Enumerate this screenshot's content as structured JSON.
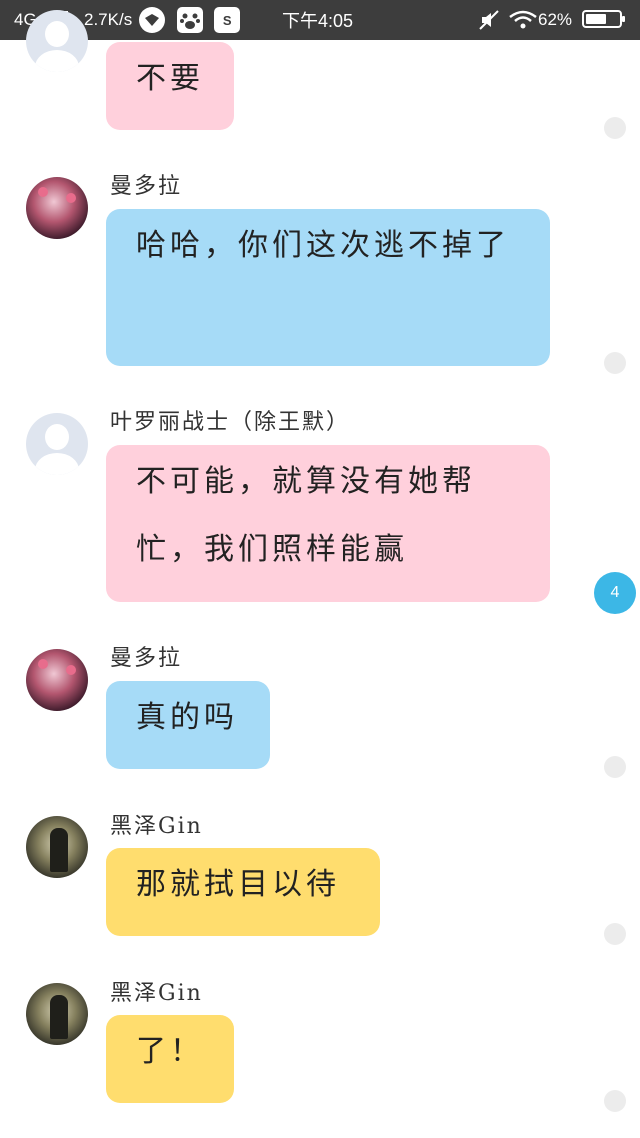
{
  "status_bar": {
    "network": "4G",
    "speed": "2.7K/s",
    "icon_box_label": "S",
    "time": "下午4:05",
    "battery_percent": "62%",
    "battery_level": 0.62,
    "icons": [
      "signal-icon",
      "bird-app-icon",
      "baidu-paw-icon",
      "s-app-icon",
      "mute-icon",
      "wifi-icon",
      "battery-icon"
    ]
  },
  "messages": [
    {
      "sender": "",
      "text": "不要",
      "bubble_color": "#ffd0dc",
      "avatar": "default-avatar-icon"
    },
    {
      "sender": "曼多拉",
      "text": "哈哈，你们这次逃不掉了",
      "bubble_color": "#a6dbf7",
      "avatar": "mandora-avatar"
    },
    {
      "sender": "叶罗丽战士（除王默）",
      "text": "不可能，就算没有她帮忙，我们照样能赢",
      "bubble_color": "#ffd0dc",
      "avatar": "default-avatar-icon"
    },
    {
      "sender": "曼多拉",
      "text": "真的吗",
      "bubble_color": "#a6dbf7",
      "avatar": "mandora-avatar"
    },
    {
      "sender": "黑泽Gin",
      "text": "那就拭目以待",
      "bubble_color": "#ffdd6e",
      "avatar": "gin-avatar"
    },
    {
      "sender": "黑泽Gin",
      "text": "了！",
      "bubble_color": "#ffdd6e",
      "avatar": "gin-avatar"
    }
  ],
  "unread_badge": "4"
}
